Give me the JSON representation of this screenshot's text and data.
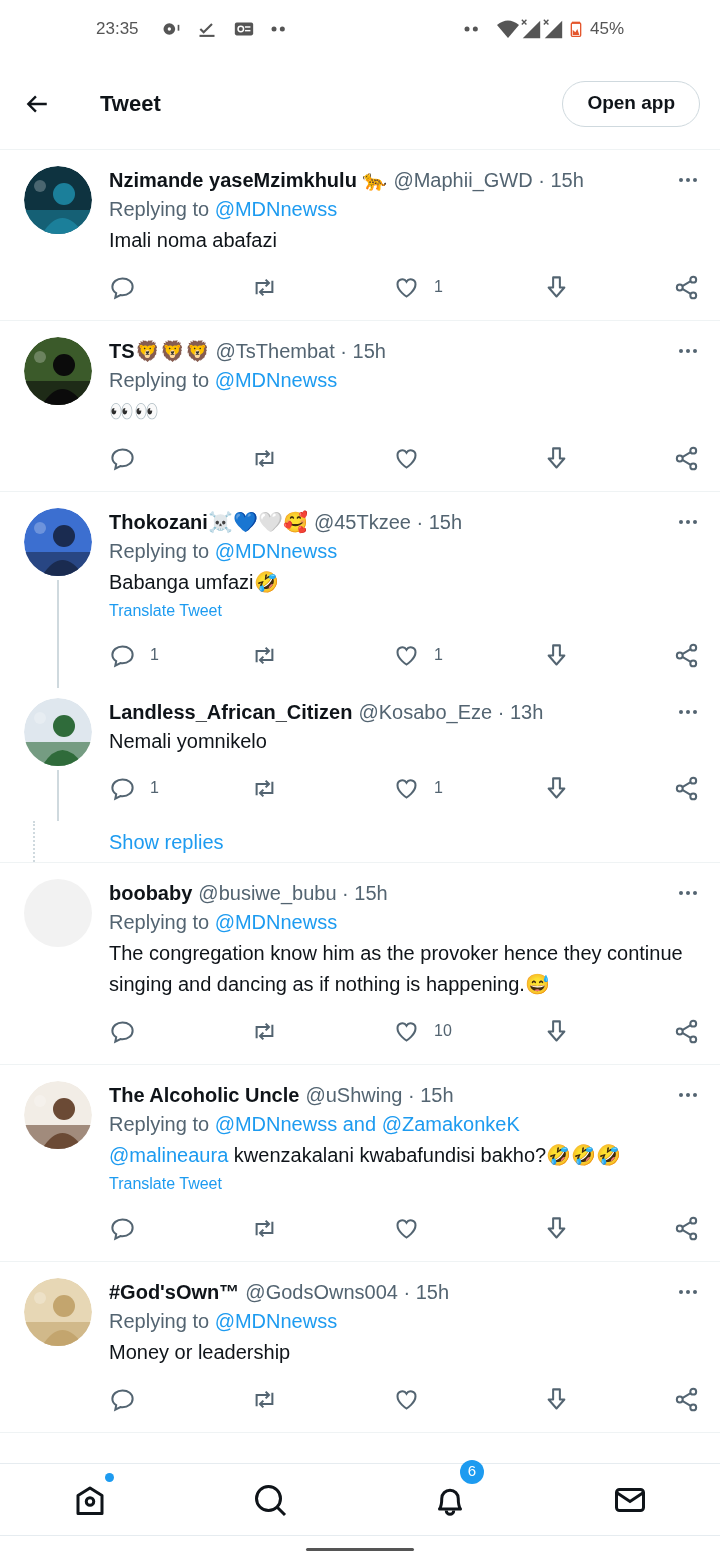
{
  "status_bar": {
    "time": "23:35",
    "battery": "45%"
  },
  "header": {
    "title": "Tweet",
    "button": "Open app"
  },
  "items": [
    {
      "kind": "tweet",
      "name": "Nzimande yaseMzimkhulu 🐆",
      "handle": "@Maphii_GWD · 15h",
      "replying_prefix": "Replying to",
      "replying_to": "@MDNnewss",
      "text": "Imali noma abafazi",
      "likes": "1",
      "thread_line": false
    },
    {
      "kind": "tweet",
      "name": "TS🦁🦁🦁",
      "handle": "@TsThembat · 15h",
      "replying_prefix": "Replying to",
      "replying_to": "@MDNnewss",
      "text": "👀👀",
      "thread_line": false
    },
    {
      "kind": "tweet",
      "name": "Thokozani☠️💙🤍🥰",
      "handle": "@45Tkzee · 15h",
      "replying_prefix": "Replying to",
      "replying_to": "@MDNnewss",
      "text": "Babanga umfazi🤣",
      "translate": "Translate Tweet",
      "replies": "1",
      "likes": "1",
      "thread_line": true
    },
    {
      "kind": "tweet",
      "name": "Landless_African_Citizen",
      "handle": "@Kosabo_Eze · 13h",
      "text": "Nemali yomnikelo",
      "replies": "1",
      "likes": "1",
      "thread_line": true
    },
    {
      "kind": "show_replies",
      "label": "Show replies"
    },
    {
      "kind": "tweet",
      "avatar": {
        "kind": "empty"
      },
      "name": "boobaby",
      "handle": "@busiwe_bubu · 15h",
      "replying_prefix": "Replying to",
      "replying_to": "@MDNnewss",
      "text": "The congregation know him as the provoker hence they continue singing and dancing as if nothing is happening.😅",
      "likes": "10",
      "thread_line": false
    },
    {
      "kind": "tweet",
      "name": "The Alcoholic Uncle",
      "handle": "@uShwing · 15h",
      "replying_prefix": "Replying to",
      "replying_to": "@MDNnewss and @ZamakonkeK",
      "mention": "@malineaura",
      "text": "kwenzakalani kwabafundisi bakho?🤣🤣🤣",
      "translate": "Translate Tweet",
      "thread_line": false
    },
    {
      "kind": "tweet",
      "name": "#God'sOwn™",
      "handle": "@GodsOwns004 · 15h",
      "replying_prefix": "Replying to",
      "replying_to": "@MDNnewss",
      "text": "Money or leadership",
      "thread_line": false
    }
  ],
  "bottom_nav": [
    {
      "kind": "home",
      "dot": true
    },
    {
      "kind": "search"
    },
    {
      "kind": "notifications",
      "badge": "6"
    },
    {
      "kind": "messages"
    }
  ]
}
